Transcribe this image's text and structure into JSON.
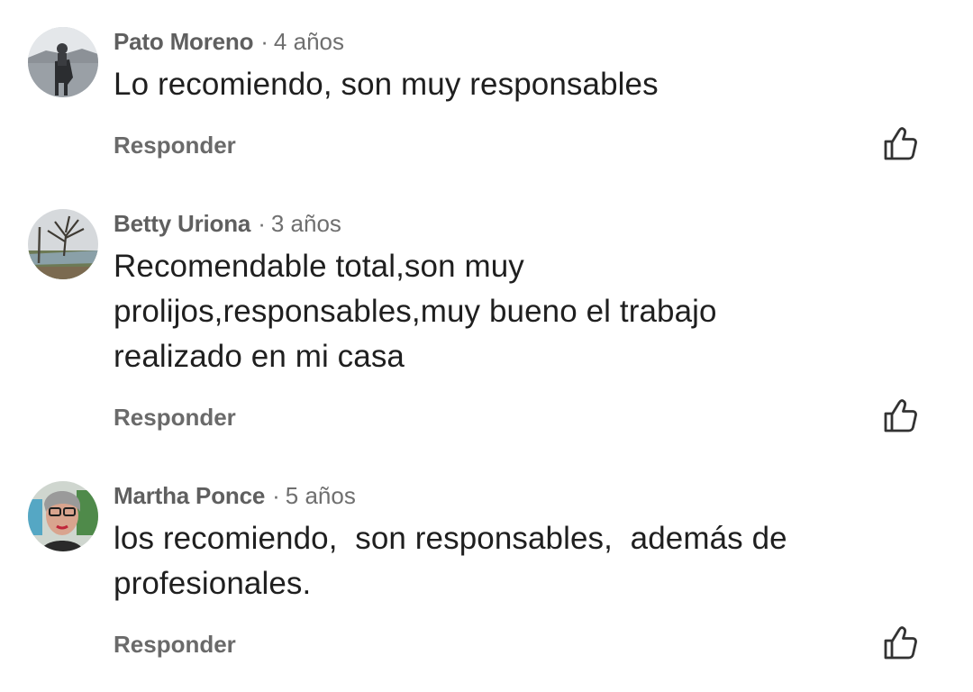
{
  "comments": [
    {
      "author": "Pato Moreno",
      "separator": "·",
      "age": "4 años",
      "text": "Lo recomiendo, son muy responsables",
      "reply_label": "Responder"
    },
    {
      "author": "Betty Uriona",
      "separator": "·",
      "age": "3 años",
      "text": "Recomendable total,son muy\nprolijos,responsables,muy bueno el trabajo\nrealizado en mi casa",
      "reply_label": "Responder"
    },
    {
      "author": "Martha Ponce",
      "separator": "·",
      "age": "5 años",
      "text": "los recomiendo,  son responsables,  además de\nprofesionales.",
      "reply_label": "Responder"
    }
  ],
  "icons": {
    "like": "thumbs-up-icon"
  },
  "colors": {
    "author": "#5f5f5f",
    "body_text": "#1f1f1f",
    "secondary": "#6f6f6f",
    "icon": "#333333"
  }
}
